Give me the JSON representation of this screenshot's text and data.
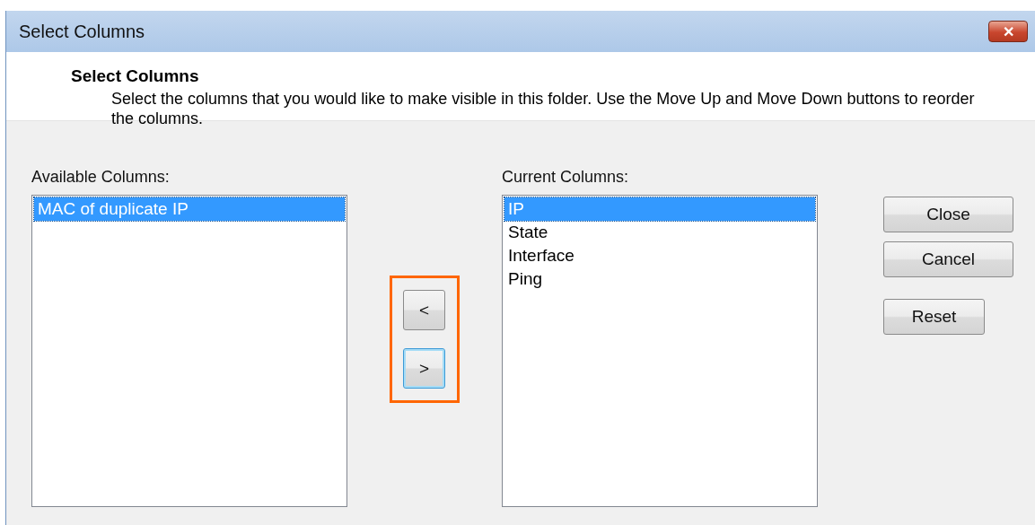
{
  "window": {
    "title": "Select Columns",
    "close_glyph": "✕"
  },
  "header": {
    "title": "Select Columns",
    "description": "Select the columns that you would like to make visible in this folder. Use the Move Up and Move Down buttons to reorder the columns."
  },
  "available": {
    "label": "Available Columns:",
    "items": [
      {
        "text": "MAC of duplicate IP",
        "selected": true
      }
    ]
  },
  "move_buttons": [
    {
      "text": "<",
      "focused": false
    },
    {
      "text": ">",
      "focused": true
    }
  ],
  "move_buttons_highlighted": true,
  "current": {
    "label": "Current Columns:",
    "items": [
      {
        "text": "IP",
        "selected": true
      },
      {
        "text": "State",
        "selected": false
      },
      {
        "text": "Interface",
        "selected": false
      },
      {
        "text": "Ping",
        "selected": false
      }
    ]
  },
  "buttons": [
    {
      "text": "Close",
      "kind": "wide"
    },
    {
      "text": "Cancel",
      "kind": "wide"
    },
    {
      "text": "Reset",
      "kind": "narrow"
    }
  ]
}
